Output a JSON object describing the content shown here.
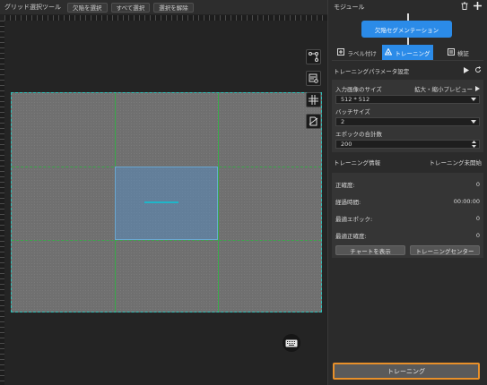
{
  "toolbar": {
    "title": "グリッド選択ツール",
    "buttons": [
      "欠陥を選択",
      "すべて選択",
      "選択を解除"
    ]
  },
  "canvas": {
    "side_tools": [
      "node-path-icon",
      "image-view-icon",
      "grid-view-icon",
      "document-view-icon"
    ],
    "keyboard_icon": "keyboard-icon",
    "grid_color": "#3aa84a",
    "selection_color": "#6aa7d0",
    "defect_color": "#1fb6c9"
  },
  "panel": {
    "title": "モジュール",
    "module_name": "欠陥セグメンテーション",
    "tabs": [
      {
        "label": "ラベル付け",
        "icon": "label-icon"
      },
      {
        "label": "トレーニング",
        "icon": "training-icon"
      },
      {
        "label": "検証",
        "icon": "verify-icon"
      }
    ],
    "params_title": "トレーニングパラメータ設定",
    "input_size_label": "入力画像のサイズ",
    "preview_label": "拡大・縮小プレビュー",
    "input_size_value": "512 * 512",
    "batch_label": "バッチサイズ",
    "batch_value": "2",
    "epoch_label": "エポックの合計数",
    "epoch_value": "200",
    "info_title": "トレーニング情報",
    "status": "トレーニング未開始",
    "info_rows": [
      {
        "label": "正確度:",
        "value": "0"
      },
      {
        "label": "経過時間:",
        "value": "00:00:00"
      },
      {
        "label": "最適エポック:",
        "value": "0"
      },
      {
        "label": "最適正確度:",
        "value": "0"
      }
    ],
    "chart_button": "チャートを表示",
    "center_button": "トレーニングセンター",
    "train_button": "トレーニング",
    "accent": "#2b8be8",
    "train_border": "#e8902a"
  }
}
